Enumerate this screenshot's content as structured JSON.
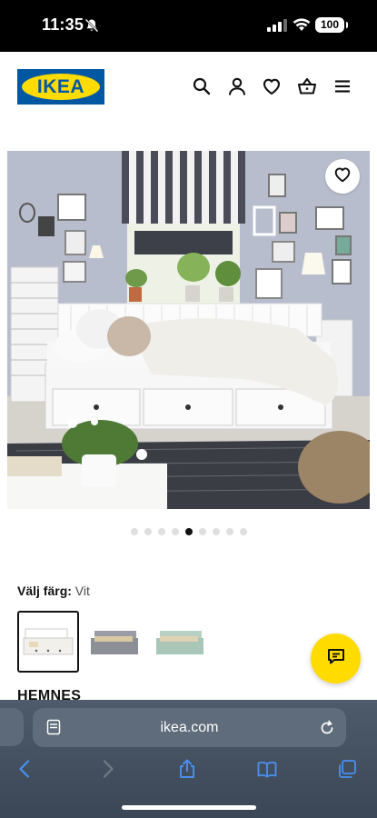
{
  "status_bar": {
    "time": "11:35",
    "battery": "100"
  },
  "header": {
    "logo_text": "IKEA",
    "icons": [
      "search-icon",
      "account-icon",
      "heart-icon",
      "cart-icon",
      "menu-icon"
    ]
  },
  "gallery": {
    "image_count": 9,
    "active_index": 4,
    "favorite_icon": "heart-outline-icon"
  },
  "color_selector": {
    "label": "Välj färg:",
    "selected_value": "Vit",
    "swatches": [
      {
        "name": "white",
        "color": "#ffffff",
        "selected": true
      },
      {
        "name": "grey",
        "color": "#8d8f97",
        "selected": false
      },
      {
        "name": "green",
        "color": "#a9c6b6",
        "selected": false
      }
    ]
  },
  "product": {
    "name": "HEMNES"
  },
  "browser": {
    "url": "ikea.com"
  },
  "colors": {
    "ikea_blue": "#0058a3",
    "ikea_yellow": "#ffdb00"
  }
}
